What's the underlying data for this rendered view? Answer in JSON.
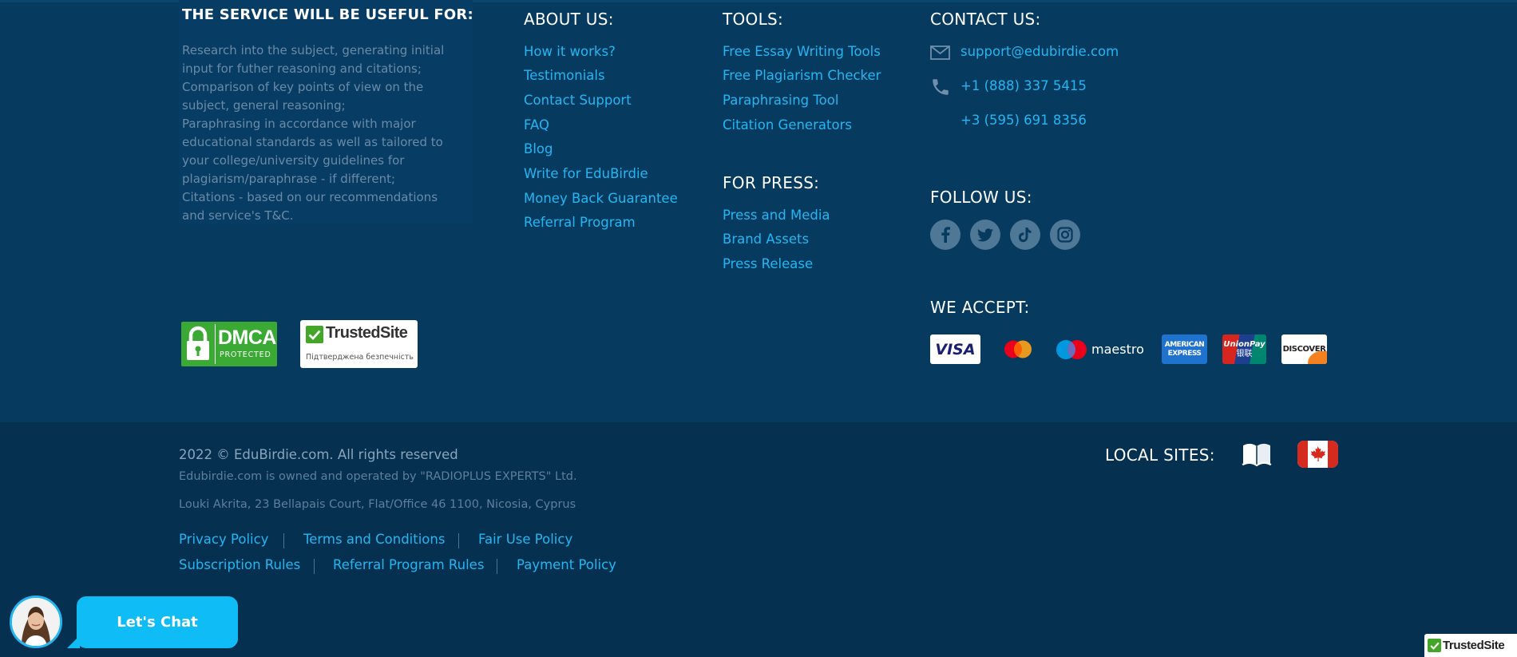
{
  "service": {
    "title": "THE SERVICE WILL BE USEFUL FOR:",
    "lines": [
      "Research into the subject, generating initial",
      "input for futher reasoning and citations;",
      "Comparison of key points of view on the",
      "subject, general reasoning;",
      "Paraphrasing in accordance with major",
      "educational standards as well as tailored to",
      "your college/university guidelines for",
      "plagiarism/paraphrase - if different;",
      "Citations - based on our recommendations",
      "and service's T&C."
    ]
  },
  "about": {
    "title": "ABOUT US:",
    "links": [
      "How it works?",
      "Testimonials",
      "Contact Support",
      "FAQ",
      "Blog",
      "Write for EduBirdie",
      "Money Back Guarantee",
      "Referral Program"
    ]
  },
  "tools": {
    "title": "TOOLS:",
    "links": [
      "Free Essay Writing Tools",
      "Free Plagiarism Checker",
      "Paraphrasing Tool",
      "Citation Generators"
    ]
  },
  "press": {
    "title": "FOR PRESS:",
    "links": [
      "Press and Media",
      "Brand Assets",
      "Press Release"
    ]
  },
  "contact": {
    "title": "CONTACT US:",
    "email": "support@edubirdie.com",
    "phone1": "+1 (888) 337 5415",
    "phone2": "+3 (595) 691 8356"
  },
  "follow": {
    "title": "FOLLOW US:",
    "icons": [
      "facebook-icon",
      "twitter-icon",
      "tiktok-icon",
      "instagram-icon"
    ]
  },
  "accept": {
    "title": "WE ACCEPT:",
    "visa": "VISA",
    "maestro": "maestro",
    "amex_line1": "AMERICAN",
    "amex_line2": "EXPRESS",
    "unionpay": "UnionPay",
    "unionpay_cn": "银联",
    "discover": "DISCOVER"
  },
  "badges": {
    "dmca_main": "DMCA",
    "dmca_sub": "PROTECTED",
    "trusted_title": "TrustedSite",
    "trusted_sub": "Підтверджена безпечність"
  },
  "bottom": {
    "copyright": "2022 © EduBirdie.com. All rights reserved",
    "owner": "Edubirdie.com is owned and operated by \"RADIOPLUS EXPERTS\" Ltd.",
    "address": "Louki Akrita, 23 Bellapais Court, Flat/Office 46 1100, Nicosia, Cyprus",
    "legal_row1": [
      "Privacy Policy",
      "Terms and Conditions",
      "Fair Use Policy"
    ],
    "legal_row2": [
      "Subscription Rules",
      "Referral Program Rules",
      "Payment Policy"
    ]
  },
  "local": {
    "title": "LOCAL SITES:"
  },
  "chat": {
    "label": "Let's Chat"
  },
  "trusted_corner": "TrustedSite",
  "colors": {
    "background": "#063a5f",
    "background_bottom": "#05304f",
    "link": "#23b6f2",
    "chat": "#0fbcf5"
  }
}
